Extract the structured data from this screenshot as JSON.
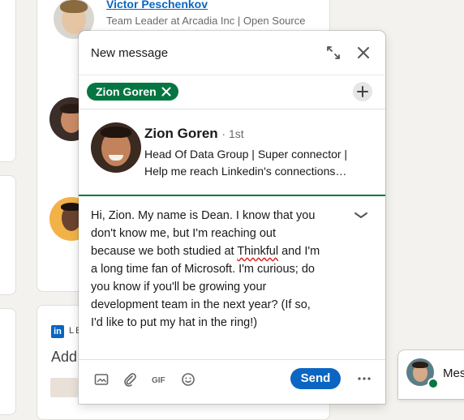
{
  "background": {
    "person_name": "Victor Peschenkov",
    "person_headline": "Team Leader at Arcadia Inc | Open Source",
    "linkedin_logo": "in",
    "linkedin_text": "LE",
    "add_text": "Add"
  },
  "message_window": {
    "title": "New message",
    "expand_icon": "expand-icon",
    "close_icon": "close-icon",
    "recipient": {
      "name": "Zion Goren",
      "remove_icon": "x-icon"
    },
    "add_recipient_icon": "plus-icon",
    "profile": {
      "name": "Zion Goren",
      "degree": "· 1st",
      "headline_line1": "Head Of Data Group | Super connector |",
      "headline_line2": "Help me reach Linkedin's connections…"
    },
    "body": {
      "line1": "Hi, Zion. My name is Dean. I know that you",
      "line2": "don't know me, but I'm reaching out",
      "line3_pre": "because we both studied at ",
      "line3_word": "Thinkful",
      "line3_post": " and I'm",
      "line4": "a long time fan of Microsoft. I'm curious; do",
      "line5": "you know if you'll be growing your",
      "line6": "development team in the next year? (If so,",
      "line7": "I'd like to put my hat in the ring!)"
    },
    "footer": {
      "send_label": "Send"
    }
  },
  "messaging_tab": {
    "label": "Mes"
  },
  "colors": {
    "linkedin_blue": "#0a66c2",
    "connection_green": "#057642",
    "page_bg": "#f3f2ef"
  }
}
